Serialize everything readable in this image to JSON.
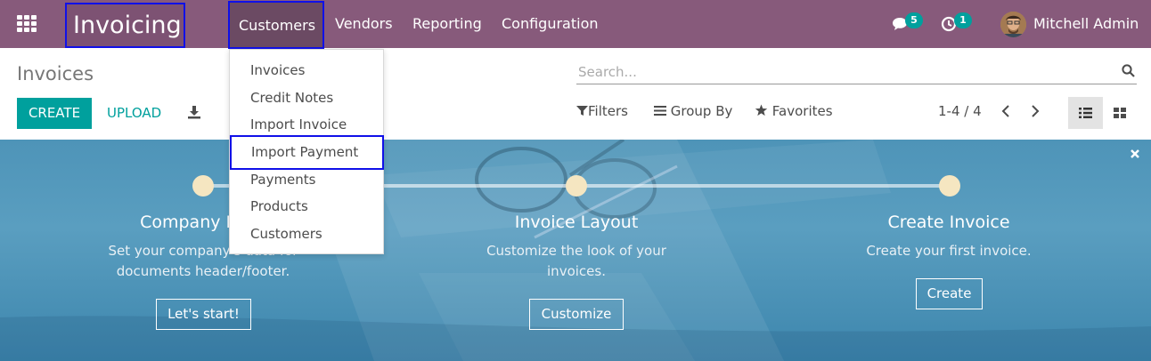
{
  "navbar": {
    "app_name": "Invoicing",
    "menus": [
      "Customers",
      "Vendors",
      "Reporting",
      "Configuration"
    ],
    "messages_badge": "5",
    "activities_badge": "1",
    "user_name": "Mitchell Admin",
    "background_color": "#875a7b"
  },
  "control_panel": {
    "title": "Invoices",
    "create_label": "CREATE",
    "upload_label": "UPLOAD",
    "search_placeholder": "Search...",
    "filters_label": "Filters",
    "group_by_label": "Group By",
    "favorites_label": "Favorites",
    "pager": "1-4 / 4",
    "accent_color": "#00a09d"
  },
  "customers_dropdown": {
    "items": [
      "Invoices",
      "Credit Notes",
      "Import Invoice",
      "Import Payment",
      "Payments",
      "Products",
      "Customers"
    ],
    "highlighted": "Import Payment"
  },
  "onboarding": {
    "steps": [
      {
        "title": "Company Data",
        "description_line1": "Set your company's data for",
        "description_line2": "documents header/footer.",
        "button": "Let's start!"
      },
      {
        "title": "Invoice Layout",
        "description_line1": "Customize the look of your",
        "description_line2": "invoices.",
        "button": "Customize"
      },
      {
        "title": "Create Invoice",
        "description_line1": "Create your first invoice.",
        "description_line2": "",
        "button": "Create"
      }
    ]
  }
}
